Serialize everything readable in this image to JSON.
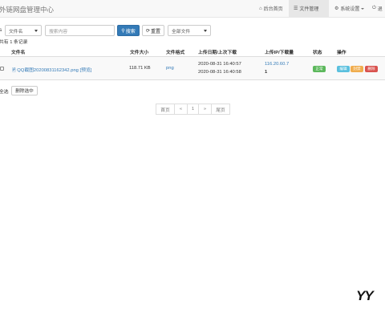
{
  "app": {
    "title": "外链网盘管理中心"
  },
  "nav": {
    "home": "后台首页",
    "files": "文件管理",
    "settings": "系统设置",
    "logout": "退"
  },
  "search": {
    "label": "s",
    "field_select": "文件名",
    "placeholder": "搜索内容",
    "search_button": "搜索",
    "reset_button": "重置",
    "filter_select": "全部文件"
  },
  "summary": {
    "total_text": "共有 1 条记录"
  },
  "table": {
    "headers": [
      "文件名",
      "文件大小",
      "文件格式",
      "上传日期/上次下载",
      "上传IP/下载量",
      "状态",
      "操作"
    ],
    "rows": [
      {
        "filename": "QQ截图20200831162342.png",
        "preview": "[预览]",
        "size": "118.71 KB",
        "format": "png",
        "upload_date": "2020-08-31 16:40:57",
        "last_download": "2020-08-31 16:40:58",
        "ip": "116.20.60.7",
        "downloads": "1",
        "status": "正常",
        "actions": {
          "edit": "编辑",
          "block": "封禁",
          "delete": "删除"
        }
      }
    ]
  },
  "bulk": {
    "select_all": "全选",
    "delete_selected": "删除选中"
  },
  "pagination": {
    "first": "首页",
    "prev": "«",
    "current": "1",
    "next": "»",
    "last": "尾页"
  },
  "watermark": "YY",
  "colors": {
    "primary": "#337ab7",
    "success": "#5cb85c",
    "info": "#5bc0de",
    "warning": "#f0ad4e",
    "danger": "#d9534f"
  }
}
